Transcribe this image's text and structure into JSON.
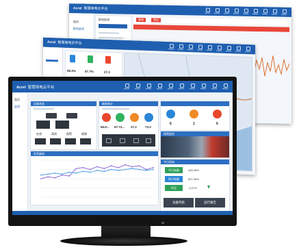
{
  "back_window": {
    "brand": "Acrel",
    "title": "智慧用电云平台",
    "sidebar": [
      "首页",
      "配电监测"
    ],
    "filter_label": "配电监测",
    "buttons": [
      "查询",
      "导出"
    ]
  },
  "mid_window": {
    "brand": "Acrel",
    "title": "智慧用电云平台",
    "stats": [
      "68.3%",
      "97.7%",
      "27.3"
    ]
  },
  "front_window": {
    "brand": "Acrel",
    "title": "智慧用电云平台",
    "sidebar": [
      "首页",
      "监测"
    ],
    "panel_titles": {
      "devices": "设备状态",
      "energy": "能耗统计",
      "video": "视频监控",
      "chart": "负荷曲线",
      "summary": "今日用电"
    },
    "device_labels": [
      "在线",
      "离线",
      "报警",
      "故障"
    ],
    "meters": [
      {
        "value": "66.8...",
        "color": "#e8472d"
      },
      {
        "value": "67.72...",
        "color": "#2fb35f"
      },
      {
        "value": "27.2",
        "color": "#f08a24"
      },
      {
        "value": "73.3",
        "color": "#2a86d8"
      }
    ],
    "counters": [
      {
        "value": "6",
        "color": "#2a86d8"
      },
      {
        "value": "1",
        "color": "#f08a24"
      },
      {
        "value": "6",
        "color": "#e8472d"
      }
    ],
    "summary_rows": [
      {
        "label": "今日电量",
        "value": "405.45%",
        "color": "#2fa05a"
      },
      {
        "label": "昨日电量",
        "value": "507.45%",
        "color": "#2a86d8"
      },
      {
        "label": "环比",
        "value": "-3.07%",
        "color": "#2fa05a"
      }
    ],
    "bottom_buttons": [
      "设备列表",
      "运行报告"
    ]
  },
  "chart_data": {
    "type": "line",
    "series": [
      {
        "values": [
          1.0,
          1.1,
          1.05,
          1.2,
          1.15,
          1.55,
          1.6,
          1.5,
          1.65,
          1.55,
          1.7,
          1.6,
          1.75,
          1.65,
          1.7,
          1.5,
          1.6
        ]
      },
      {
        "values": [
          1.2,
          1.25,
          1.3,
          1.25,
          1.35,
          1.3,
          1.4,
          1.35,
          1.45,
          1.4,
          1.5,
          1.45,
          1.5,
          1.55,
          1.5,
          1.45,
          1.5
        ]
      }
    ],
    "colors": [
      "#8f6ad6",
      "#4aa0e6"
    ],
    "ylim": [
      0,
      2
    ],
    "grid": true
  }
}
